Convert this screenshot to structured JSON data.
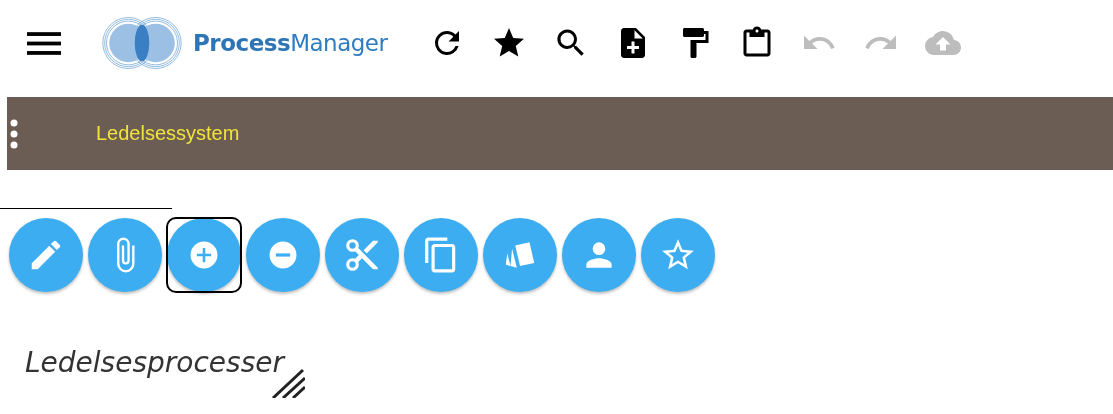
{
  "app_name": "**Process**Manager",
  "toolbar": [
    {
      "kind": "refresh",
      "disabled": false
    },
    {
      "kind": "star",
      "disabled": false
    },
    {
      "kind": "search",
      "disabled": false
    },
    {
      "kind": "new-file",
      "disabled": false
    },
    {
      "kind": "paint",
      "disabled": false
    },
    {
      "kind": "clipboard",
      "disabled": false
    },
    {
      "kind": "undo",
      "disabled": true
    },
    {
      "kind": "redo",
      "disabled": true
    },
    {
      "kind": "upload",
      "disabled": true
    }
  ],
  "title_bar": {
    "title": "Ledelsessystem"
  },
  "actions": [
    {
      "kind": "edit",
      "selected": false
    },
    {
      "kind": "attach",
      "selected": false
    },
    {
      "kind": "add",
      "selected": true
    },
    {
      "kind": "remove",
      "selected": false
    },
    {
      "kind": "cut",
      "selected": false
    },
    {
      "kind": "copy",
      "selected": false
    },
    {
      "kind": "cards",
      "selected": false
    },
    {
      "kind": "person",
      "selected": false
    },
    {
      "kind": "favorite",
      "selected": false
    }
  ],
  "heading": "Ledelsesprocesser"
}
